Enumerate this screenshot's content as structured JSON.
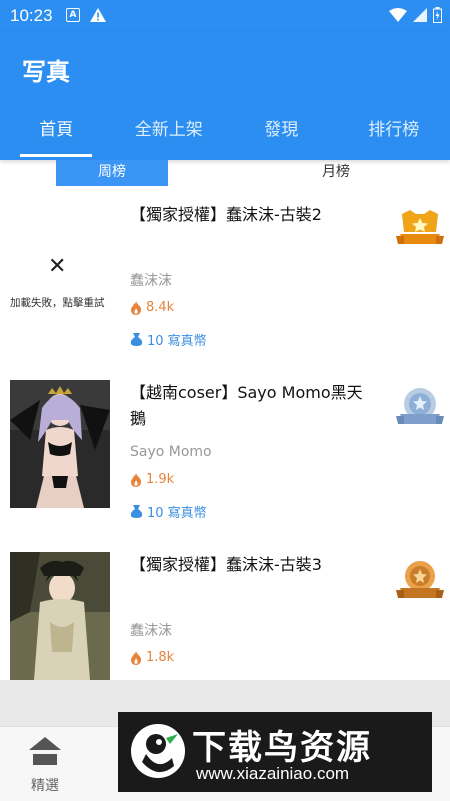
{
  "status_bar": {
    "time": "10:23"
  },
  "app": {
    "title": "写真"
  },
  "tabs": [
    {
      "label": "首頁",
      "active": true
    },
    {
      "label": "全新上架"
    },
    {
      "label": "發現"
    },
    {
      "label": "排行榜"
    }
  ],
  "rank_tabs": {
    "week": "周榜",
    "month": "月榜"
  },
  "items": [
    {
      "title": "【獨家授權】蠢沫沫-古裝2",
      "author": "蠢沫沫",
      "heat": "8.4k",
      "price": "10 寫真幣",
      "load_fail_text": "加載失敗，點擊重試",
      "badge": "gold-medal"
    },
    {
      "title": "【越南coser】Sayo Momo黑天鵝",
      "author": "Sayo Momo",
      "heat": "1.9k",
      "price": "10 寫真幣",
      "badge": "silver-medal"
    },
    {
      "title": "【獨家授權】蠢沫沫-古裝3",
      "author": "蠢沫沫",
      "heat": "1.8k",
      "badge": "bronze-medal"
    }
  ],
  "bottom_nav": [
    {
      "label": "精選",
      "icon": "home-icon"
    }
  ],
  "watermark": {
    "cn": "下载鸟资源",
    "url": "www.xiazainiao.com"
  },
  "colors": {
    "primary": "#2b8ef0",
    "heat": "#e8833a",
    "coin": "#3b8fe0"
  }
}
